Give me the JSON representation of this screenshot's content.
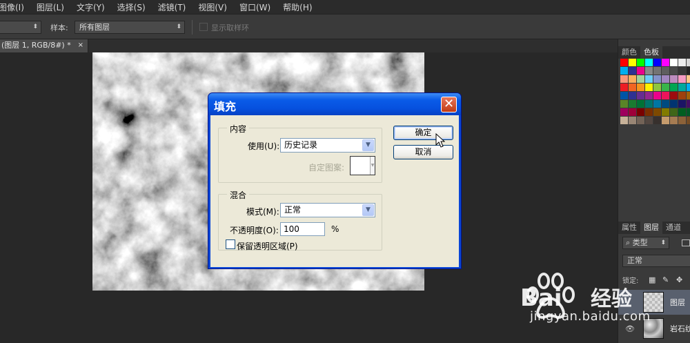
{
  "menu": [
    "图像(I)",
    "图层(L)",
    "文字(Y)",
    "选择(S)",
    "滤镜(T)",
    "视图(V)",
    "窗口(W)",
    "帮助(H)"
  ],
  "options": {
    "sample_label": "样本:",
    "sample_value": "所有图层",
    "show_ring_label": "显示取样环"
  },
  "doc_tab": {
    "title": "(图层 1, RGB/8#) *",
    "close": "×"
  },
  "panels": {
    "top_tabs": [
      "颜色",
      "色板"
    ],
    "bottom_tabs": [
      "属性",
      "图层",
      "通道"
    ],
    "filter_kind": "类型",
    "blend_mode": "正常",
    "lock_label": "锁定:",
    "layers": [
      {
        "name": "图层",
        "selected": true
      },
      {
        "name": "岩石纹",
        "selected": false
      }
    ],
    "swatch_colors": [
      "#ff0000",
      "#ffff00",
      "#00ff00",
      "#00ffff",
      "#0000ff",
      "#ff00ff",
      "#ffffff",
      "#ebebeb",
      "#d6d6d6",
      "#c2c2c2",
      "#00aeef",
      "#2e3192",
      "#ec008c",
      "#898989",
      "#737373",
      "#5e5e5e",
      "#494949",
      "#363636",
      "#222222",
      "#111111",
      "#f7977a",
      "#fbaf5d",
      "#a3d39c",
      "#6dcff6",
      "#8493ca",
      "#a186be",
      "#bd8cbf",
      "#f49ac2",
      "#fdc68a",
      "#c4df9b",
      "#ed1c24",
      "#f26522",
      "#f7941d",
      "#fff200",
      "#8dc63f",
      "#39b54a",
      "#00a651",
      "#00a99d",
      "#00aeef",
      "#0072bc",
      "#0054a6",
      "#2e3192",
      "#662d91",
      "#92278f",
      "#ec008c",
      "#ed145b",
      "#9e0b0f",
      "#a0410d",
      "#a36209",
      "#aba000",
      "#598527",
      "#1a7b30",
      "#007236",
      "#00746b",
      "#0076a3",
      "#004b80",
      "#003471",
      "#1b1464",
      "#440e62",
      "#630460",
      "#9e005d",
      "#9e0039",
      "#790000",
      "#7b2e00",
      "#7d4900",
      "#827b00",
      "#406618",
      "#005e20",
      "#005826",
      "#005952",
      "#c7b299",
      "#998675",
      "#736357",
      "#534741",
      "#37302d",
      "#c69c6d",
      "#a67c52",
      "#8c6239",
      "#754c24",
      "#603913"
    ]
  },
  "dialog": {
    "title": "填充",
    "close": "✕",
    "contents_legend": "内容",
    "use_label": "使用(U):",
    "use_value": "历史记录",
    "pattern_label": "自定图案:",
    "blend_legend": "混合",
    "mode_label": "模式(M):",
    "mode_value": "正常",
    "opacity_label": "不透明度(O):",
    "opacity_value": "100",
    "opacity_unit": "%",
    "preserve_label": "保留透明区域(P)",
    "ok": "确定",
    "cancel": "取消"
  },
  "watermark": {
    "text": "jingyan.baidu.com"
  }
}
